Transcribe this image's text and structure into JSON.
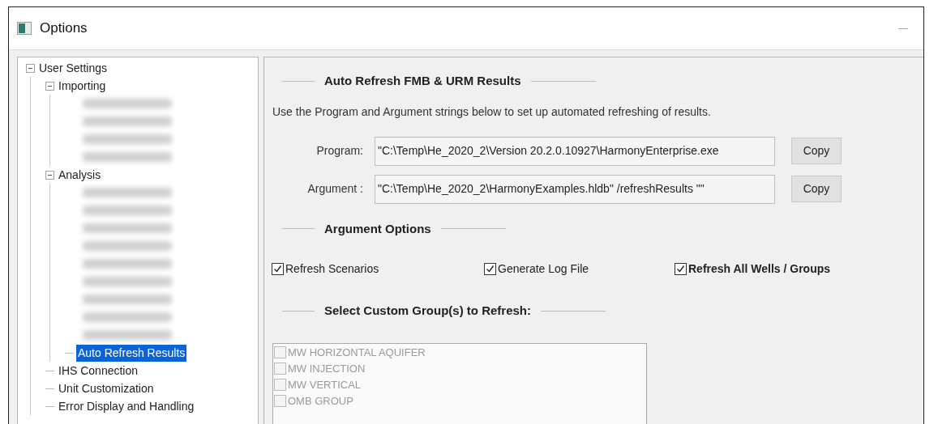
{
  "window": {
    "title": "Options"
  },
  "tree": [
    {
      "label": "User Settings",
      "expanded": true,
      "selected": false,
      "children": [
        {
          "label": "Importing",
          "expanded": true,
          "selected": false,
          "children": [
            {
              "kind": "blurred"
            },
            {
              "kind": "blurred"
            },
            {
              "kind": "blurred"
            },
            {
              "kind": "blurred"
            }
          ]
        },
        {
          "label": "Analysis",
          "expanded": true,
          "selected": false,
          "children": [
            {
              "kind": "blurred"
            },
            {
              "kind": "blurred"
            },
            {
              "kind": "blurred"
            },
            {
              "kind": "blurred"
            },
            {
              "kind": "blurred"
            },
            {
              "kind": "blurred"
            },
            {
              "kind": "blurred"
            },
            {
              "kind": "blurred"
            },
            {
              "kind": "blurred"
            },
            {
              "label": "Auto Refresh Results",
              "selected": true
            }
          ]
        },
        {
          "label": "IHS Connection",
          "selected": false
        },
        {
          "label": "Unit Customization",
          "selected": false
        },
        {
          "label": "Error Display and Handling",
          "selected": false
        }
      ]
    }
  ],
  "auto_refresh": {
    "heading": "Auto Refresh FMB & URM Results",
    "description": "Use the Program and Argument strings below to set up automated refreshing of results.",
    "fields": [
      {
        "label": "Program:",
        "value": "\"C:\\Temp\\He_2020_2\\Version 20.2.0.10927\\HarmonyEnterprise.exe",
        "button": "Copy"
      },
      {
        "label": "Argument :",
        "value": "\"C:\\Temp\\He_2020_2\\HarmonyExamples.hldb\" /refreshResults \"\"",
        "button": "Copy"
      }
    ]
  },
  "argument_options": {
    "heading": "Argument Options",
    "options": [
      {
        "label": "Refresh Scenarios",
        "checked": true,
        "emphasized": false
      },
      {
        "label": "Generate Log File",
        "checked": true,
        "emphasized": false
      },
      {
        "label": "Refresh All Wells / Groups",
        "checked": true,
        "emphasized": true
      }
    ]
  },
  "custom_groups": {
    "heading": "Select Custom Group(s) to Refresh:",
    "disabled": true,
    "items": [
      {
        "label": "MW HORIZONTAL AQUIFER",
        "checked": false
      },
      {
        "label": "MW INJECTION",
        "checked": false
      },
      {
        "label": "MW VERTICAL",
        "checked": false
      },
      {
        "label": "OMB GROUP",
        "checked": false
      }
    ]
  }
}
